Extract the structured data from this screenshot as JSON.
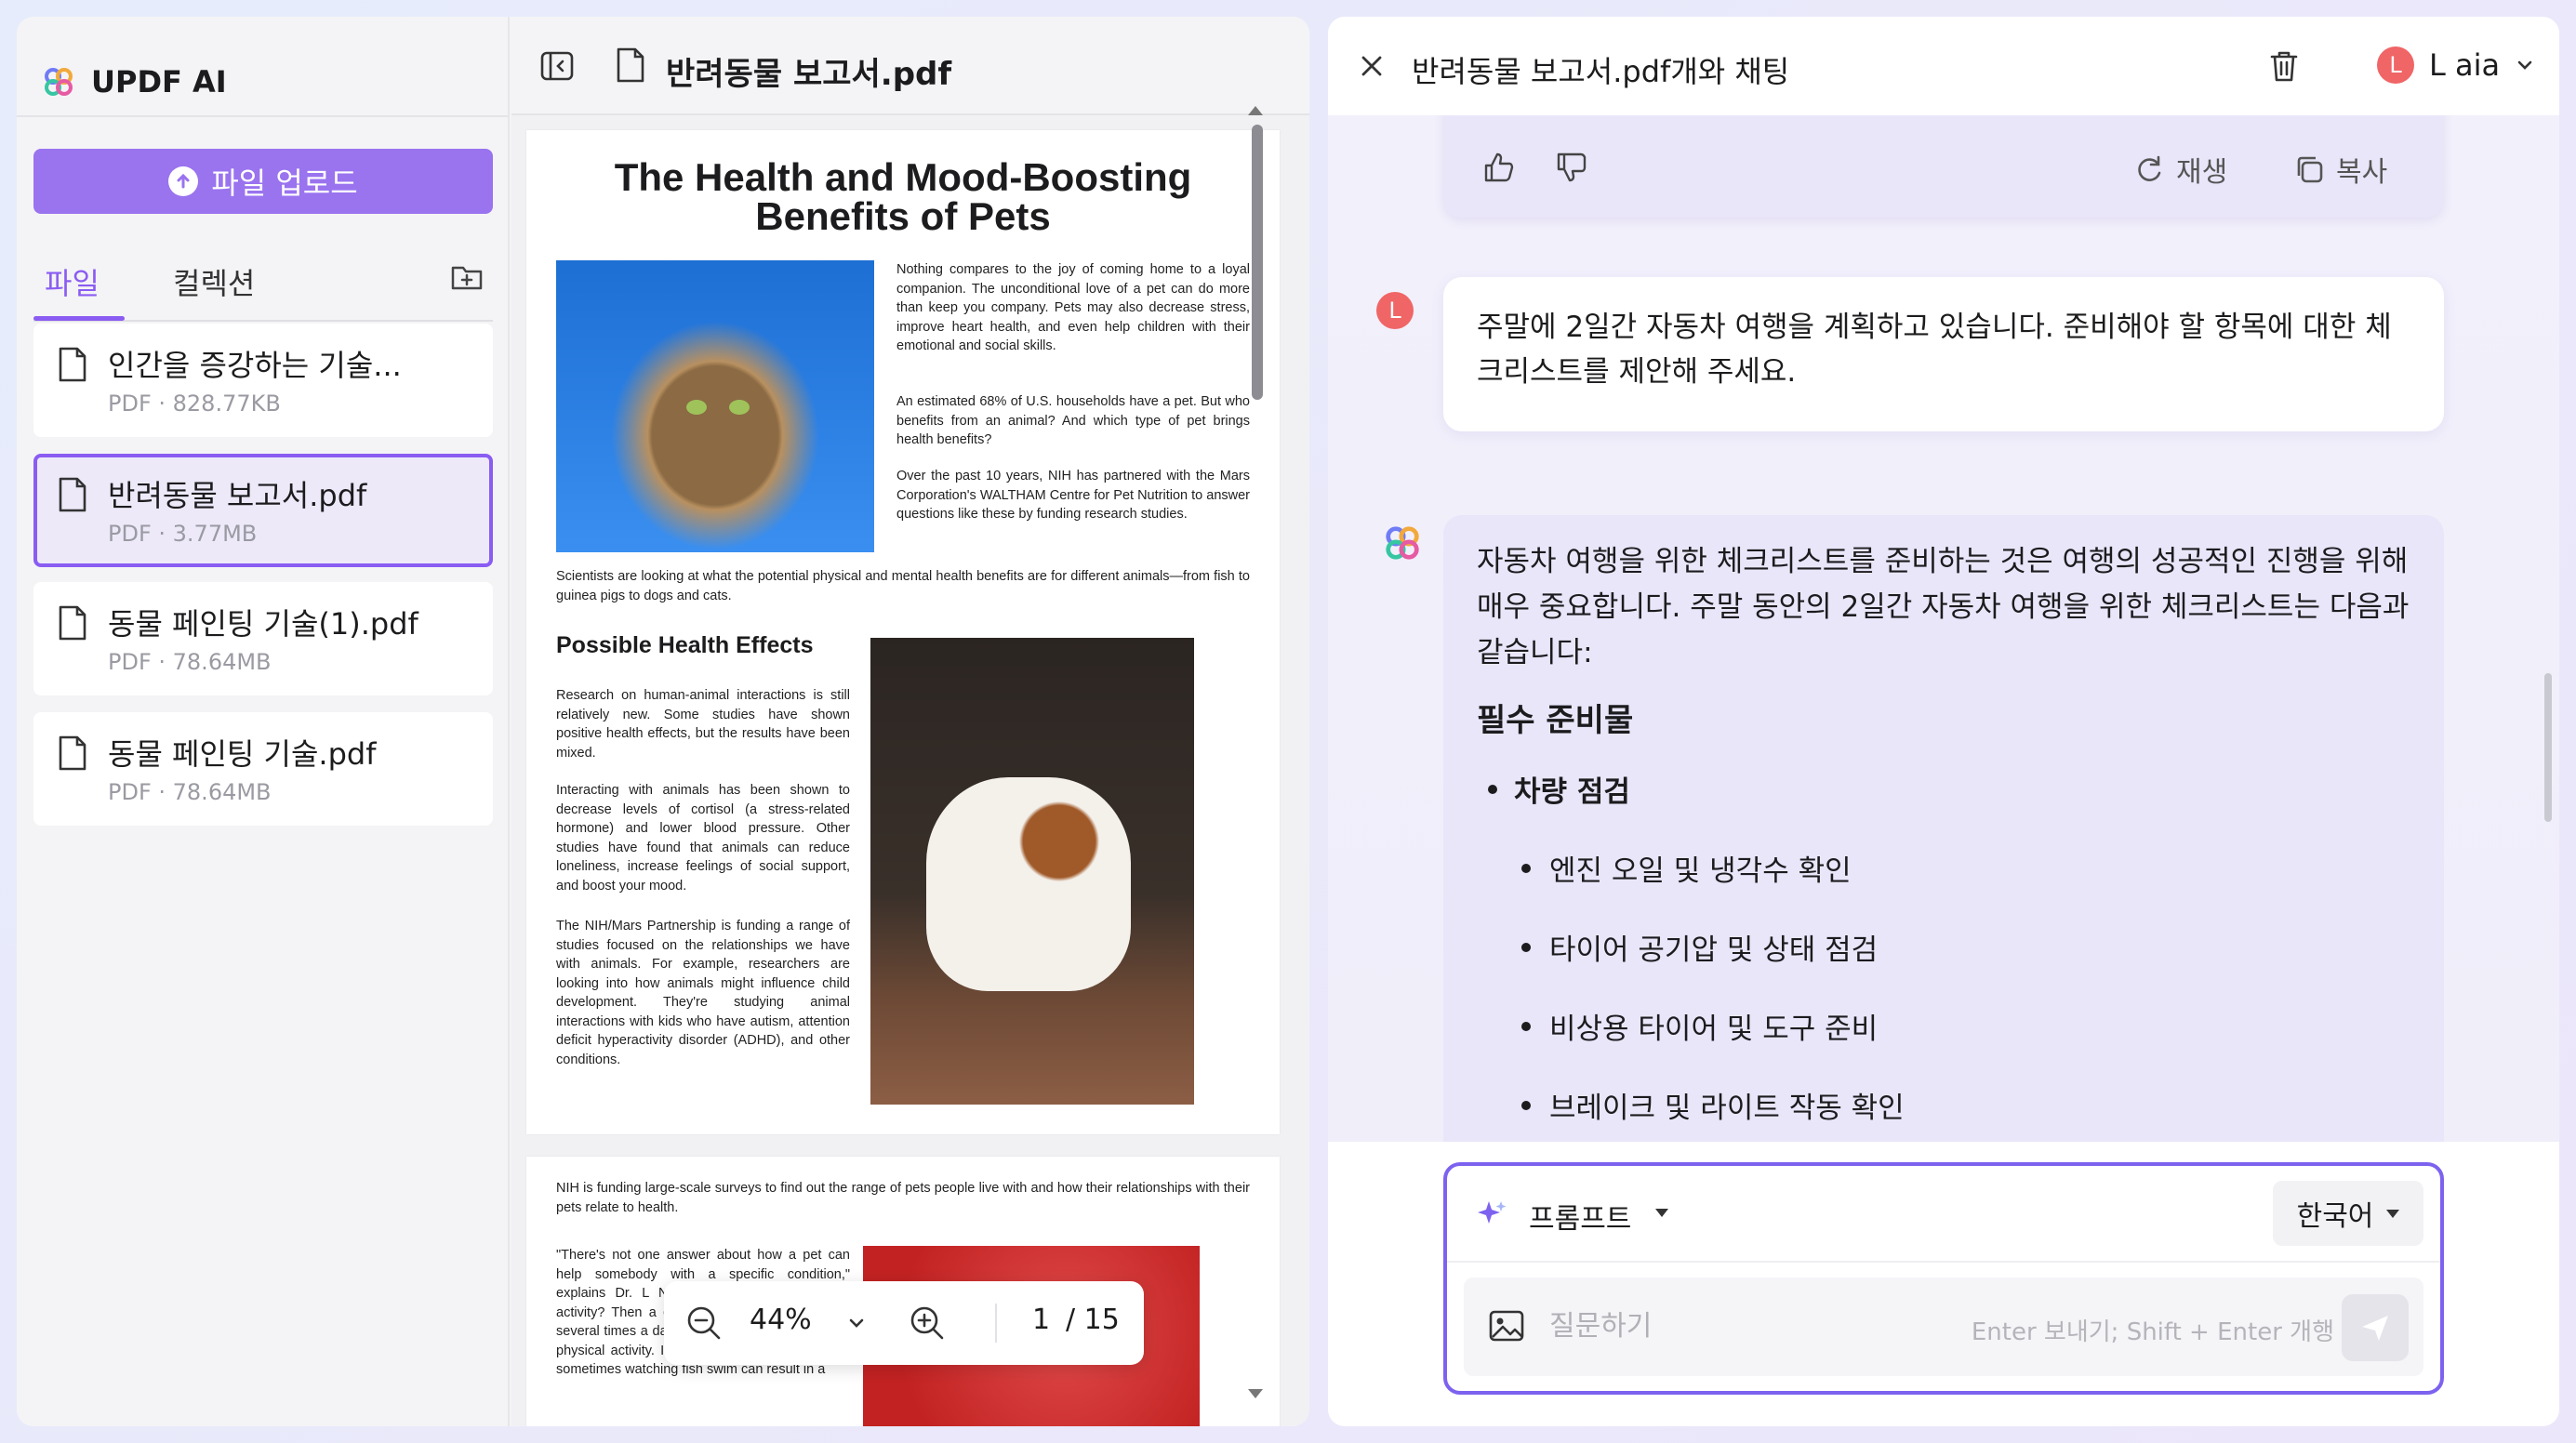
{
  "sidebar": {
    "brand": "UPDF AI",
    "upload_label": "파일 업로드",
    "tabs": {
      "files": "파일",
      "collections": "컬렉션"
    },
    "files": [
      {
        "name": "인간을 증강하는 기술...",
        "meta": "PDF · 828.77KB"
      },
      {
        "name": "반려동물 보고서.pdf",
        "meta": "PDF · 3.77MB",
        "selected": true
      },
      {
        "name": "동물 페인팅 기술(1).pdf",
        "meta": "PDF · 78.64MB"
      },
      {
        "name": "동물 페인팅 기술.pdf",
        "meta": "PDF · 78.64MB"
      }
    ]
  },
  "viewer": {
    "title": "반려동물 보고서.pdf",
    "zoom": "44%",
    "page_current": "1",
    "page_total": "/ 15",
    "document": {
      "title_line1": "The Health and Mood-Boosting",
      "title_line2": "Benefits of Pets",
      "intro_p1": "Nothing compares to the joy of coming home to a loyal companion. The unconditional love of a pet can do more than keep you company. Pets may also decrease stress, improve heart health, and even help children with their emotional and social skills.",
      "intro_p2": "An estimated 68% of U.S. households have a pet. But who benefits from an animal? And which type of pet brings health benefits?",
      "intro_p3": "Over the past 10 years, NIH has partnered with the Mars Corporation's WALTHAM Centre for Pet Nutrition to answer questions like these by funding research studies.",
      "scientists": "Scientists are looking at what the potential physical and mental health benefits are for different animals—from fish to guinea pigs to dogs and cats.",
      "heading": "Possible Health Effects",
      "effects_p1": "Research on human-animal interactions is still relatively new. Some studies have shown positive health effects, but the results have been mixed.",
      "effects_p2": "Interacting with animals has been shown to decrease levels of cortisol (a stress-related hormone) and lower blood pressure. Other studies have found that animals can reduce loneliness, increase feelings of social support, and boost your mood.",
      "effects_p3": "The NIH/Mars Partnership is funding a range of studies focused on the relationships we have with animals. For example, researchers are looking into how animals might influence child development. They're studying animal interactions with kids who have autism, attention deficit hyperactivity disorder (ADHD), and other conditions.",
      "page2_p1": "NIH is funding large-scale surveys to find out the range of pets people live with and how their relationships with their pets relate to health.",
      "page2_p2": "\"There's not one answer about how a pet can help somebody with a specific condition,\" explains Dr. L NIH's Human Program. \"Is y activity? Then a dog. You have to walk a dog several times a day and you're going to increase physical activity. If your goal is reducing stress, sometimes watching fish swim can result in a"
    }
  },
  "chat": {
    "title": "반려동물 보고서.pdf개와 채팅",
    "user_name": "L aia",
    "user_initial": "L",
    "actions": {
      "regenerate": "재생",
      "copy": "복사"
    },
    "user_message": "주말에 2일간 자동차 여행을 계획하고 있습니다. 준비해야 할 항목에 대한 체크리스트를 제안해 주세요.",
    "ai_intro": "자동차 여행을 위한 체크리스트를 준비하는 것은 여행의 성공적인 진행을 위해 매우 중요합니다. 주말 동안의 2일간 자동차 여행을 위한 체크리스트는 다음과 같습니다:",
    "ai_heading": "필수 준비물",
    "ai_list_title": "차량 점검",
    "ai_items": [
      "엔진 오일 및 냉각수 확인",
      "타이어 공기압 및 상태 점검",
      "비상용 타이어 및 도구 준비",
      "브레이크 및 라이트 작동 확인"
    ],
    "composer": {
      "prompt_label": "프롬프트",
      "language": "한국어",
      "placeholder": "질문하기",
      "hint": "Enter 보내기; Shift + Enter 개행"
    }
  },
  "colors": {
    "accent": "#8a5cf2",
    "upload_button": "#9a73ef",
    "avatar": "#f06566",
    "chat_bg": "#eae6fa"
  }
}
